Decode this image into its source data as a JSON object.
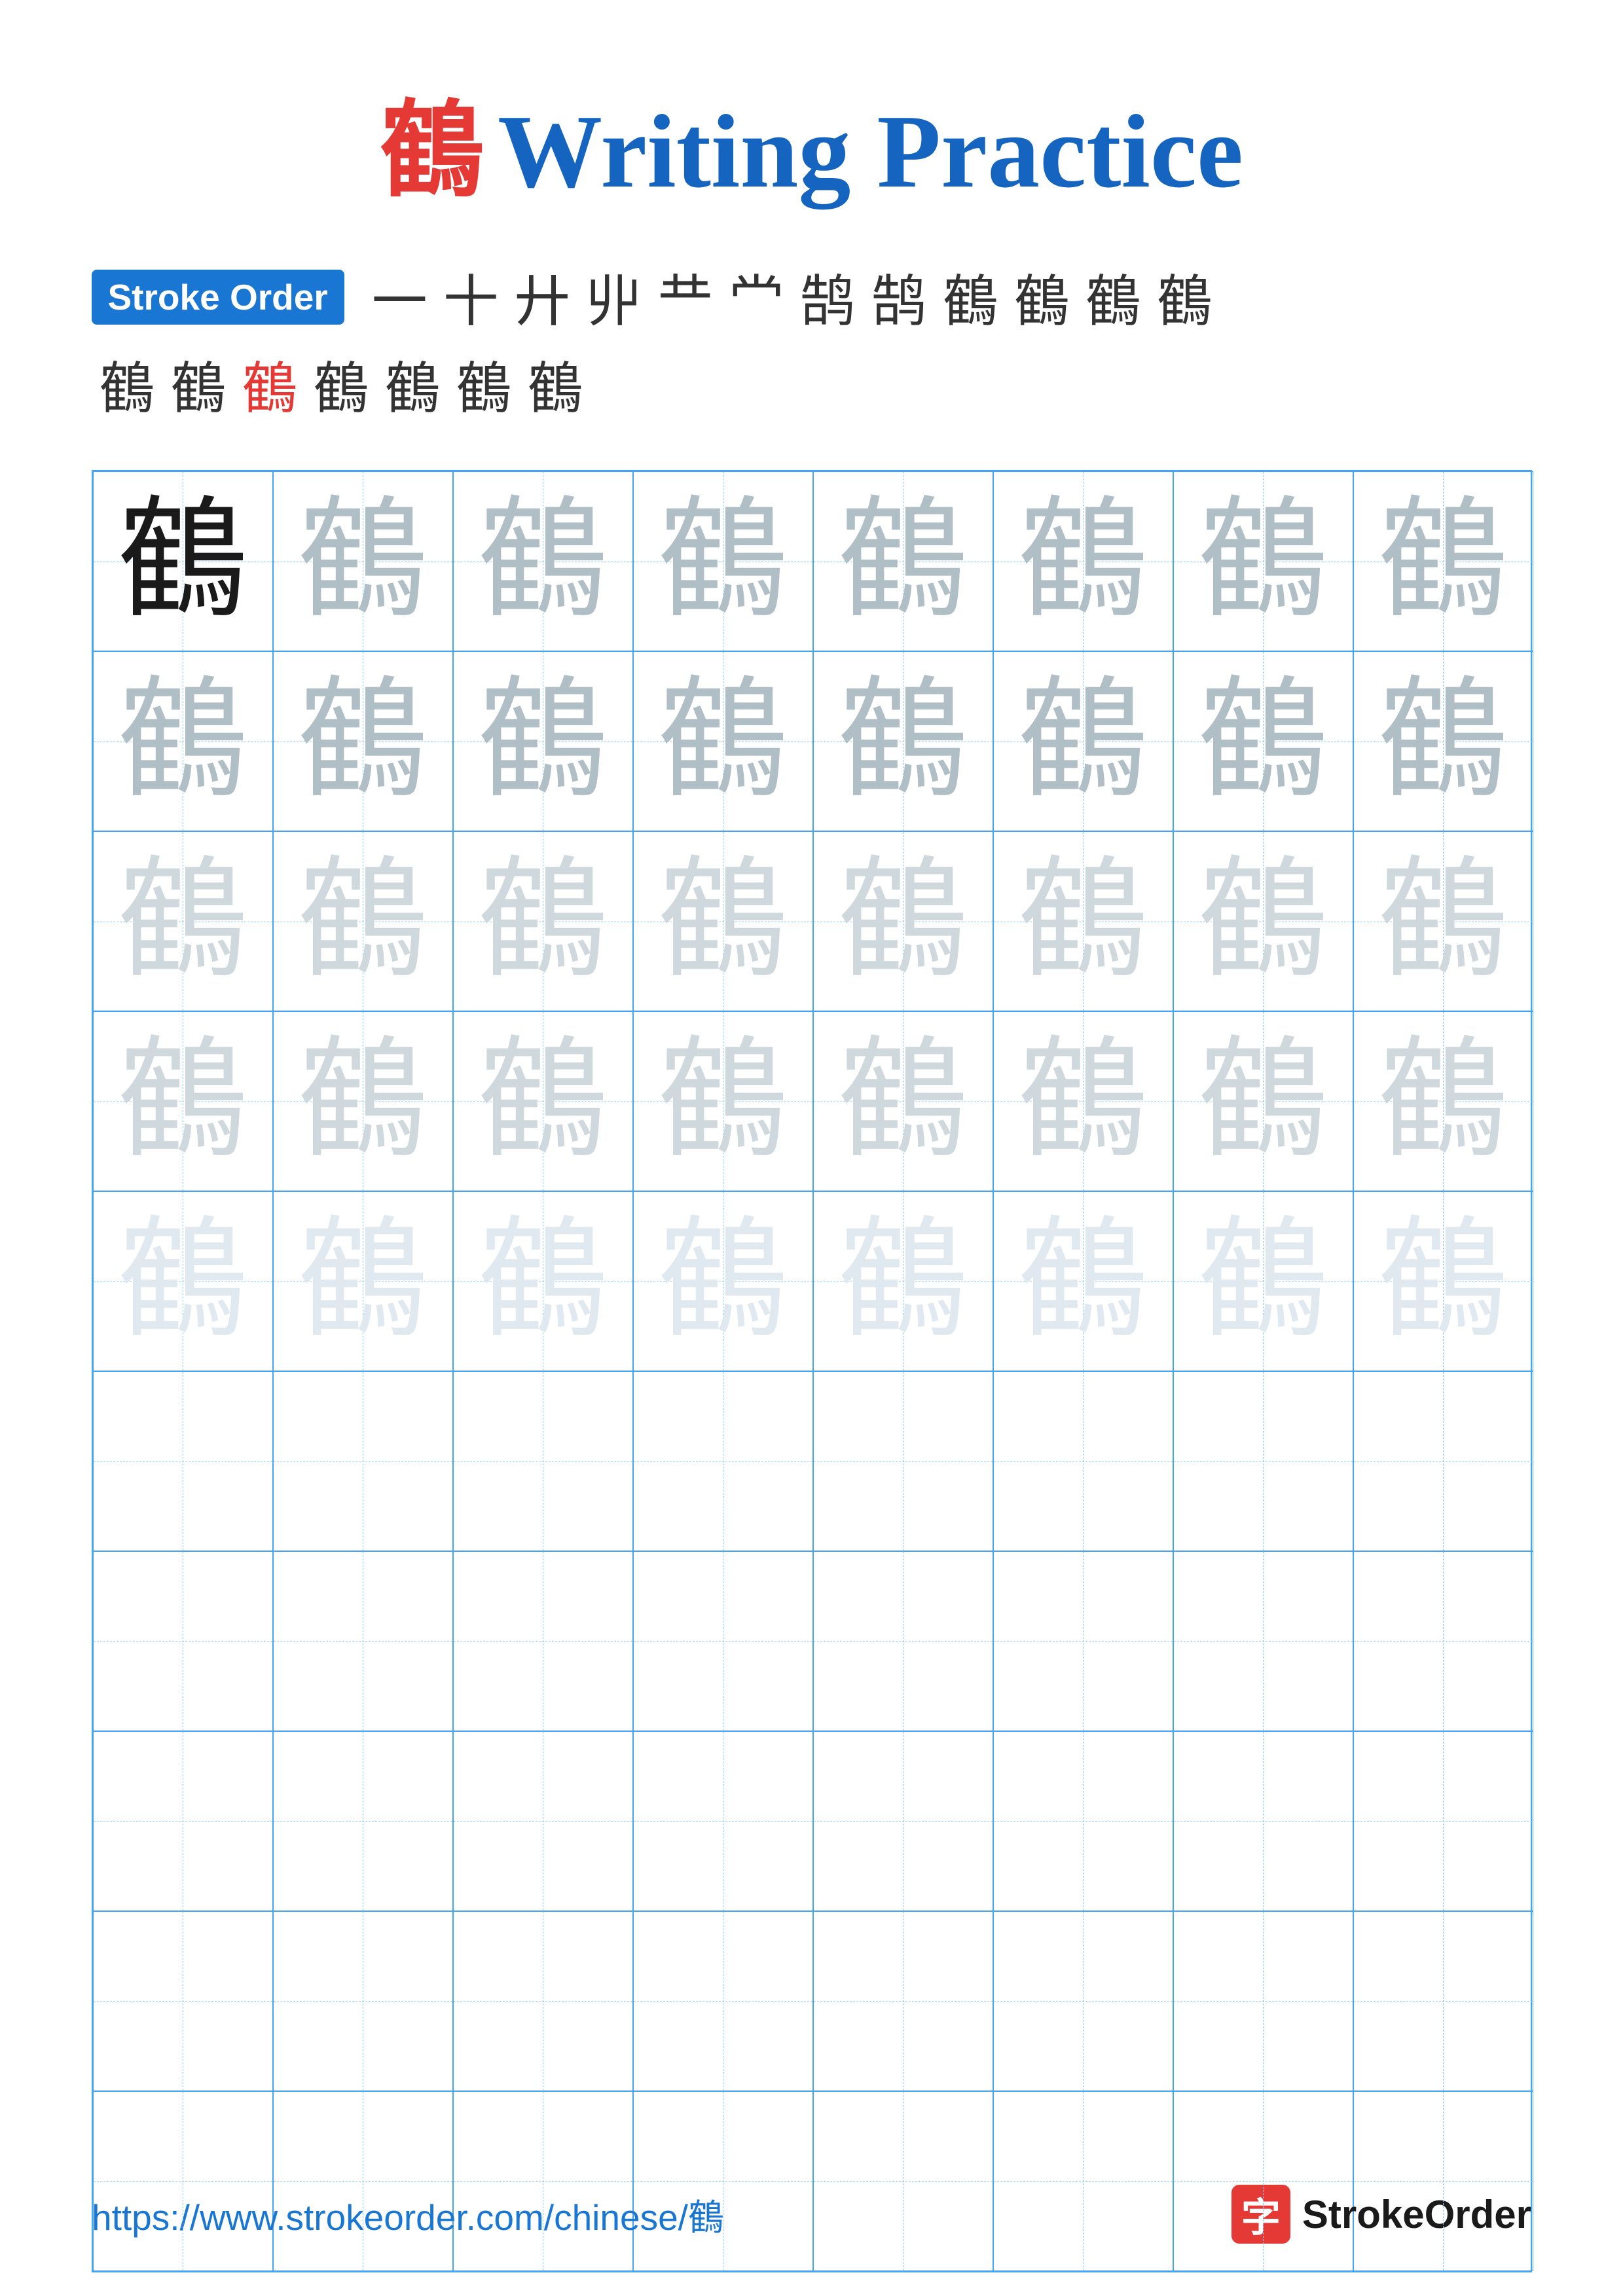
{
  "title": {
    "char": "鶴",
    "label": "Writing Practice",
    "full": "鶴 Writing Practice"
  },
  "strokeOrder": {
    "badge": "Stroke Order",
    "strokes": [
      {
        "char": "一",
        "red": false
      },
      {
        "char": "十",
        "red": false
      },
      {
        "char": "廾",
        "red": false
      },
      {
        "char": "丱",
        "red": false
      },
      {
        "char": "廾",
        "red": false
      },
      {
        "char": "龷",
        "red": false
      },
      {
        "char": "昔",
        "red": false
      },
      {
        "char": "昔",
        "red": false
      },
      {
        "char": "普",
        "red": false
      },
      {
        "char": "普",
        "red": false
      },
      {
        "char": "普",
        "red": false
      },
      {
        "char": "鹤",
        "red": false
      },
      {
        "char": "鹤",
        "red": false
      },
      {
        "char": "鹤",
        "red": false
      },
      {
        "char": "鹤",
        "red": true
      },
      {
        "char": "鶴",
        "red": false
      },
      {
        "char": "鶴",
        "red": false
      },
      {
        "char": "鶴",
        "red": false
      },
      {
        "char": "鶴",
        "red": false
      }
    ]
  },
  "grid": {
    "rows": 10,
    "cols": 8,
    "char": "鶴",
    "cells": [
      "dark",
      "medium",
      "medium",
      "medium",
      "medium",
      "medium",
      "medium",
      "medium",
      "medium",
      "medium",
      "medium",
      "medium",
      "medium",
      "medium",
      "medium",
      "medium",
      "light",
      "light",
      "light",
      "light",
      "light",
      "light",
      "light",
      "light",
      "light",
      "light",
      "light",
      "light",
      "light",
      "light",
      "light",
      "light",
      "very-light",
      "very-light",
      "very-light",
      "very-light",
      "very-light",
      "very-light",
      "very-light",
      "very-light",
      "empty",
      "empty",
      "empty",
      "empty",
      "empty",
      "empty",
      "empty",
      "empty",
      "empty",
      "empty",
      "empty",
      "empty",
      "empty",
      "empty",
      "empty",
      "empty",
      "empty",
      "empty",
      "empty",
      "empty",
      "empty",
      "empty",
      "empty",
      "empty",
      "empty",
      "empty",
      "empty",
      "empty",
      "empty",
      "empty",
      "empty",
      "empty",
      "empty",
      "empty",
      "empty",
      "empty",
      "empty",
      "empty",
      "empty",
      "empty"
    ]
  },
  "footer": {
    "url": "https://www.strokeorder.com/chinese/鶴",
    "logoIcon": "字",
    "logoText": "StrokeOrder"
  }
}
